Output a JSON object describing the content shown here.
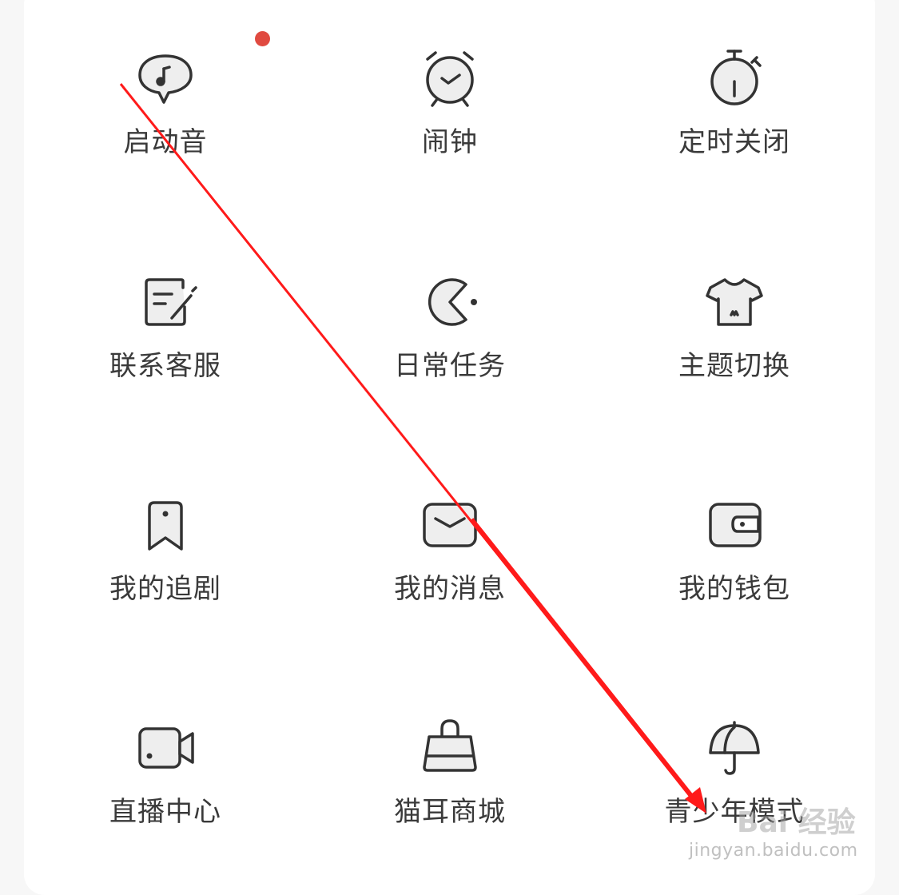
{
  "menu": {
    "items": [
      {
        "label": "启动音",
        "icon": "music-bubble-icon"
      },
      {
        "label": "闹钟",
        "icon": "alarm-clock-icon"
      },
      {
        "label": "定时关闭",
        "icon": "timer-icon"
      },
      {
        "label": "联系客服",
        "icon": "edit-note-icon"
      },
      {
        "label": "日常任务",
        "icon": "pacman-icon"
      },
      {
        "label": "主题切换",
        "icon": "tshirt-icon"
      },
      {
        "label": "我的追剧",
        "icon": "bookmark-icon"
      },
      {
        "label": "我的消息",
        "icon": "message-envelope-icon"
      },
      {
        "label": "我的钱包",
        "icon": "wallet-icon"
      },
      {
        "label": "直播中心",
        "icon": "video-camera-icon"
      },
      {
        "label": "猫耳商城",
        "icon": "shopping-bag-icon"
      },
      {
        "label": "青少年模式",
        "icon": "umbrella-icon"
      }
    ]
  },
  "badge": {
    "color": "#e04a40"
  },
  "annotation": {
    "color": "#ff1a1a"
  },
  "watermark": {
    "text": "Bai 经验",
    "url": "jingyan.baidu.com"
  }
}
